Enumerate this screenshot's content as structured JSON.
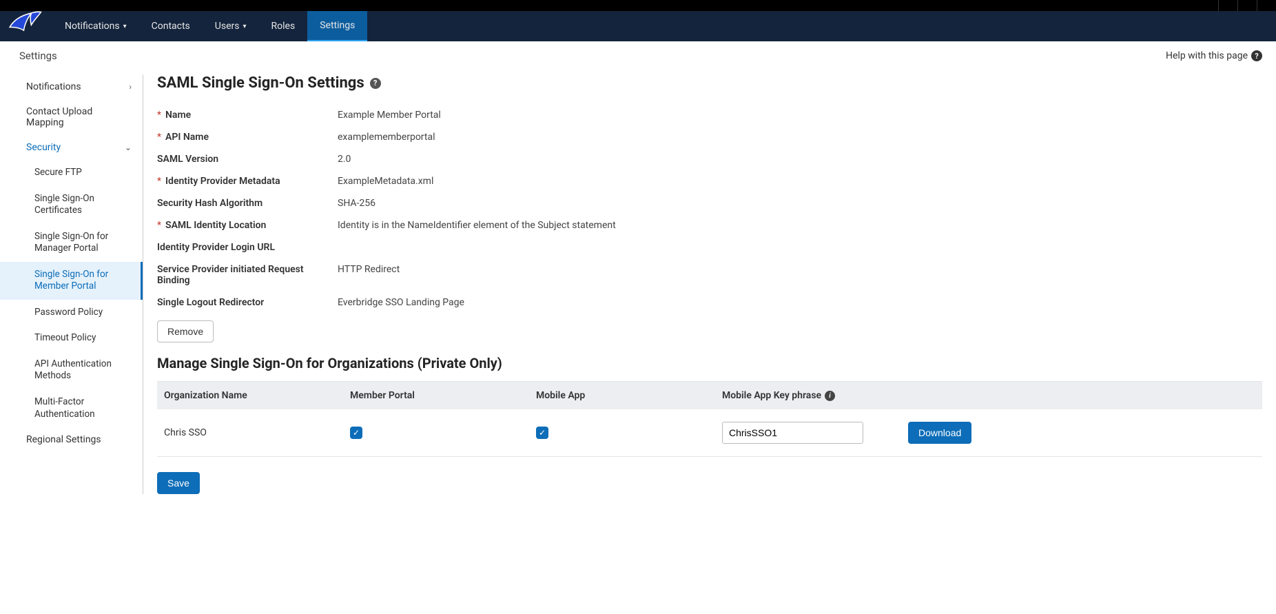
{
  "nav": {
    "items": [
      {
        "label": "Notifications",
        "caret": true
      },
      {
        "label": "Contacts"
      },
      {
        "label": "Users",
        "caret": true
      },
      {
        "label": "Roles"
      },
      {
        "label": "Settings",
        "active": true
      }
    ]
  },
  "header": {
    "crumb": "Settings",
    "help": "Help with this page"
  },
  "sidebar": {
    "items": [
      {
        "label": "Notifications",
        "type": "top",
        "arrow": "right"
      },
      {
        "label": "Contact Upload Mapping",
        "type": "top"
      },
      {
        "label": "Security",
        "type": "top",
        "expanded": true,
        "arrow": "down"
      },
      {
        "label": "Secure FTP",
        "type": "sub"
      },
      {
        "label": "Single Sign-On Certificates",
        "type": "sub"
      },
      {
        "label": "Single Sign-On for Manager Portal",
        "type": "sub"
      },
      {
        "label": "Single Sign-On for Member Portal",
        "type": "sub",
        "active": true
      },
      {
        "label": "Password Policy",
        "type": "sub"
      },
      {
        "label": "Timeout Policy",
        "type": "sub"
      },
      {
        "label": "API Authentication Methods",
        "type": "sub"
      },
      {
        "label": "Multi-Factor Authentication",
        "type": "sub"
      },
      {
        "label": "Regional Settings",
        "type": "top"
      }
    ]
  },
  "page": {
    "title": "SAML Single Sign-On Settings",
    "fields": [
      {
        "label": "Name",
        "required": true,
        "value": "Example Member Portal"
      },
      {
        "label": "API Name",
        "required": true,
        "value": "examplememberportal"
      },
      {
        "label": "SAML Version",
        "required": false,
        "value": "2.0"
      },
      {
        "label": "Identity Provider Metadata",
        "required": true,
        "value": "ExampleMetadata.xml"
      },
      {
        "label": "Security Hash Algorithm",
        "required": false,
        "value": "SHA-256"
      },
      {
        "label": "SAML Identity Location",
        "required": true,
        "value": "Identity is in the NameIdentifier element of the Subject statement"
      },
      {
        "label": "Identity Provider Login URL",
        "required": false,
        "value": ""
      },
      {
        "label": "Service Provider initiated Request Binding",
        "required": false,
        "value": "HTTP Redirect"
      },
      {
        "label": "Single Logout Redirector",
        "required": false,
        "value": "Everbridge SSO Landing Page"
      }
    ],
    "remove_label": "Remove",
    "section2_title": "Manage Single Sign-On for Organizations (Private Only)",
    "table": {
      "headers": {
        "org": "Organization Name",
        "mp": "Member Portal",
        "app": "Mobile App",
        "key": "Mobile App Key phrase"
      },
      "rows": [
        {
          "org": "Chris SSO",
          "mp": true,
          "app": true,
          "key": "ChrisSSO1",
          "download": "Download"
        }
      ]
    },
    "save_label": "Save"
  }
}
